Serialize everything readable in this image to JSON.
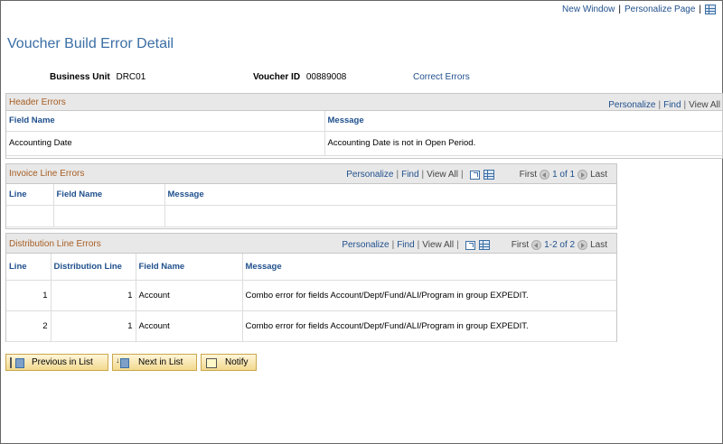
{
  "topbar": {
    "new_window": "New Window",
    "personalize_page": "Personalize Page"
  },
  "page": {
    "title": "Voucher Build Error Detail"
  },
  "info": {
    "business_unit_label": "Business Unit",
    "business_unit_value": "DRC01",
    "voucher_id_label": "Voucher ID",
    "voucher_id_value": "00889008",
    "correct_errors": "Correct Errors"
  },
  "header_errors": {
    "title": "Header Errors",
    "personalize": "Personalize",
    "find": "Find",
    "view_all": "View All",
    "columns": [
      "Field Name",
      "Message"
    ],
    "rows": [
      {
        "field_name": "Accounting Date",
        "message": "Accounting Date is not in Open Period."
      }
    ]
  },
  "invoice_line_errors": {
    "title": "Invoice Line Errors",
    "personalize": "Personalize",
    "find": "Find",
    "view_all": "View All",
    "first": "First",
    "range": "1 of 1",
    "last": "Last",
    "columns": [
      "Line",
      "Field Name",
      "Message"
    ]
  },
  "distribution_line_errors": {
    "title": "Distribution Line Errors",
    "personalize": "Personalize",
    "find": "Find",
    "view_all": "View All",
    "first": "First",
    "range": "1-2 of 2",
    "last": "Last",
    "columns": [
      "Line",
      "Distribution Line",
      "Field Name",
      "Message"
    ],
    "rows": [
      {
        "line": "1",
        "dist_line": "1",
        "field_name": "Account",
        "message": "Combo error for fields Account/Dept/Fund/ALI/Program in group EXPEDIT."
      },
      {
        "line": "2",
        "dist_line": "1",
        "field_name": "Account",
        "message": "Combo error for fields Account/Dept/Fund/ALI/Program in group EXPEDIT."
      }
    ]
  },
  "buttons": {
    "previous": "Previous in List",
    "next": "Next in List",
    "notify": "Notify"
  },
  "colors": {
    "title": "#3a6ea5",
    "link": "#1f4f8c",
    "section_title": "#a65d22",
    "button_bg": "#f2d98e"
  }
}
